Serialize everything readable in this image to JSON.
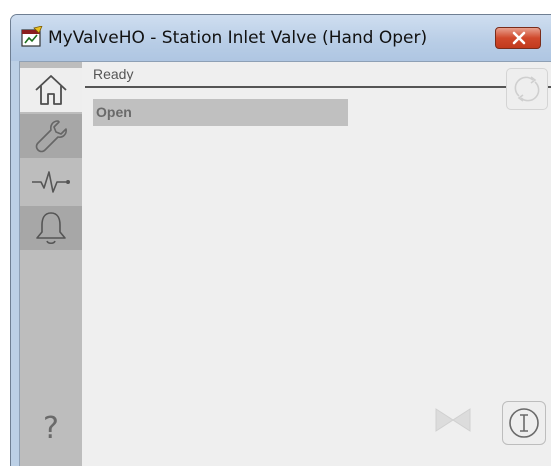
{
  "window": {
    "title": "MyValveHO - Station Inlet Valve (Hand Oper)"
  },
  "sidebar": {
    "items": [
      {
        "icon": "home-icon",
        "active": true
      },
      {
        "icon": "wrench-icon",
        "active": false
      },
      {
        "icon": "trend-icon",
        "active": false
      },
      {
        "icon": "bell-icon",
        "active": false
      }
    ],
    "help_label": "?"
  },
  "main": {
    "status_text": "Ready",
    "state_value": "Open"
  },
  "colors": {
    "title_bar": "#bcd0e6",
    "close_button": "#d0492c",
    "sidebar": "#bdbdbd",
    "content_bg": "#efefef",
    "state_field": "#c0c0c0"
  }
}
